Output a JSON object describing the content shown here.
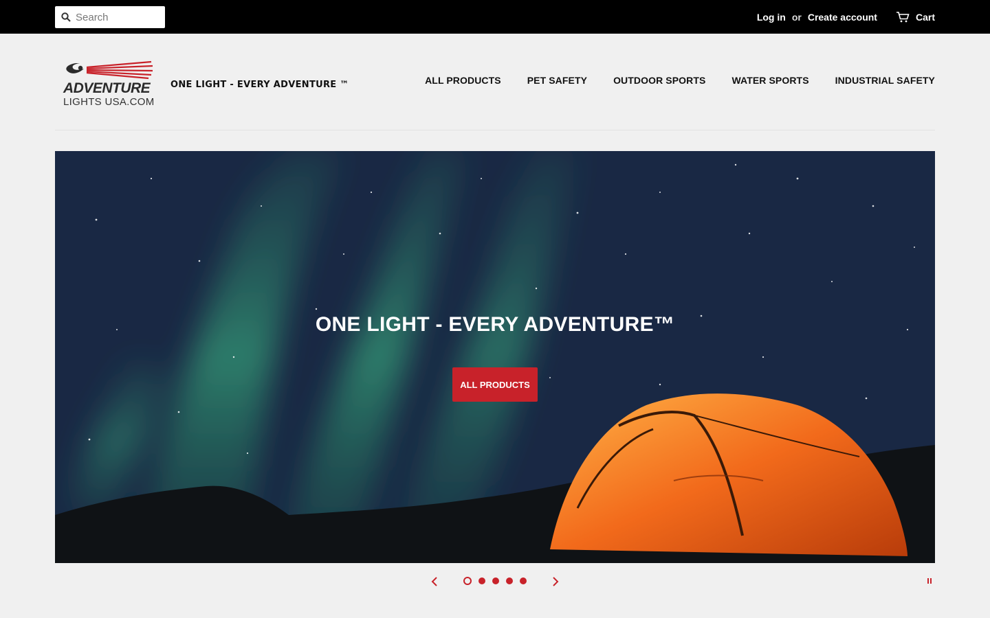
{
  "search": {
    "placeholder": "Search"
  },
  "account": {
    "login": "Log in",
    "or": "or",
    "create": "Create account",
    "cart": "Cart"
  },
  "brand": {
    "logo_word": "ADVENTURE",
    "logo_sub": "LIGHTS USA.COM",
    "tagline": "ONE LIGHT - EVERY ADVENTURE ™"
  },
  "nav": {
    "items": [
      {
        "label": "ALL PRODUCTS"
      },
      {
        "label": "PET SAFETY"
      },
      {
        "label": "OUTDOOR SPORTS"
      },
      {
        "label": "WATER SPORTS"
      },
      {
        "label": "INDUSTRIAL SAFETY"
      }
    ]
  },
  "hero": {
    "title": "ONE LIGHT - EVERY ADVENTURE™",
    "button": "ALL PRODUCTS"
  },
  "slideshow": {
    "slide_count": 5,
    "active_slide": 1
  },
  "colors": {
    "accent": "#c8222a",
    "topbar": "#000000",
    "page_bg": "#f0f0f0"
  },
  "icons": [
    "search-icon",
    "cart-icon",
    "chevron-left-icon",
    "chevron-right-icon",
    "pause-icon"
  ]
}
